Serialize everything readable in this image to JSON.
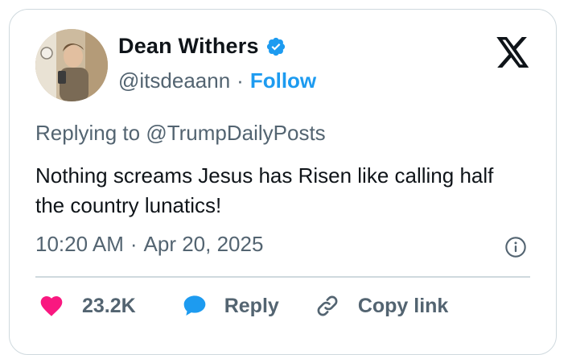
{
  "author": {
    "display_name": "Dean Withers",
    "handle": "@itsdeaann",
    "separator": "·",
    "follow_label": "Follow"
  },
  "reply_context": {
    "prefix": "Replying to",
    "mention": "@TrumpDailyPosts"
  },
  "tweet": {
    "text": "Nothing screams Jesus has Risen like calling half the country lunatics!",
    "time": "10:20 AM",
    "separator": "·",
    "date": "Apr 20, 2025"
  },
  "actions": {
    "like_count": "23.2K",
    "reply_label": "Reply",
    "copy_label": "Copy link"
  },
  "colors": {
    "accent": "#1d9bf0",
    "like": "#f91880",
    "secondary_text": "#536471",
    "border": "#cfd9de"
  },
  "icons": [
    "verified-badge-icon",
    "x-logo-icon",
    "info-icon",
    "heart-icon",
    "reply-bubble-icon",
    "link-icon"
  ]
}
